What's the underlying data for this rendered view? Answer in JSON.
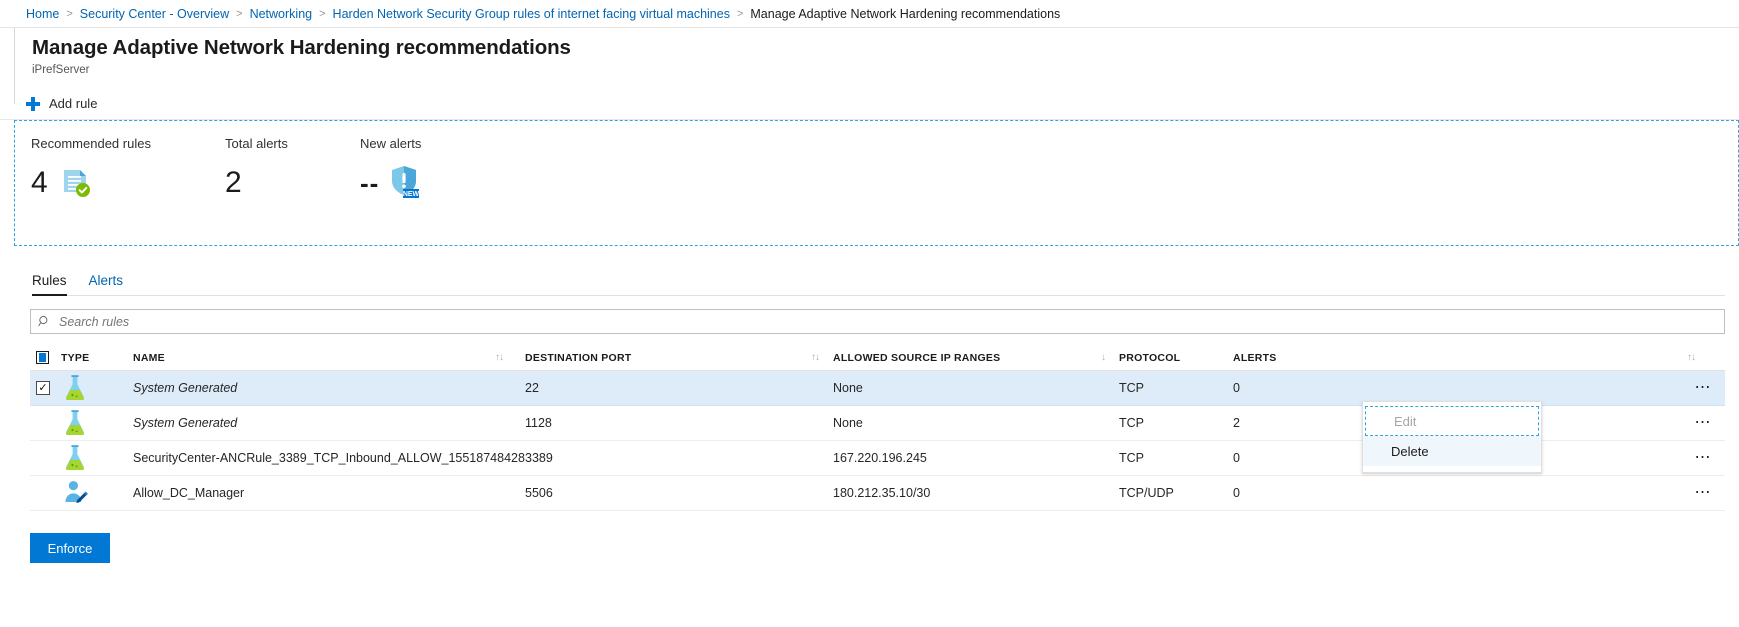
{
  "breadcrumb": {
    "items": [
      {
        "label": "Home",
        "link": true
      },
      {
        "label": "Security Center - Overview",
        "link": true
      },
      {
        "label": "Networking",
        "link": true
      },
      {
        "label": "Harden Network Security Group rules of internet facing virtual machines",
        "link": true
      },
      {
        "label": "Manage Adaptive Network Hardening recommendations",
        "link": false
      }
    ],
    "separator": ">"
  },
  "header": {
    "title": "Manage Adaptive Network Hardening recommendations",
    "subtitle": "iPrefServer"
  },
  "toolbar": {
    "add_rule_label": "Add rule",
    "add_rule_icon": "plus-icon"
  },
  "stats": [
    {
      "label": "Recommended rules",
      "value": "4",
      "icon": "rules-document-icon"
    },
    {
      "label": "Total alerts",
      "value": "2",
      "icon": ""
    },
    {
      "label": "New alerts",
      "value": "--",
      "icon": "new-alert-shield-icon",
      "badge": "NEW"
    }
  ],
  "tabs": [
    {
      "label": "Rules",
      "active": true
    },
    {
      "label": "Alerts",
      "active": false
    }
  ],
  "search": {
    "placeholder": "Search rules",
    "value": "",
    "icon": "search-icon"
  },
  "table": {
    "columns": [
      {
        "label": "TYPE",
        "sortable": false
      },
      {
        "label": "NAME",
        "sortable": true,
        "sort_icon": "sort-updown-icon"
      },
      {
        "label": "DESTINATION PORT",
        "sortable": true,
        "sort_icon": "sort-updown-icon"
      },
      {
        "label": "ALLOWED SOURCE IP RANGES",
        "sortable": true,
        "sort_icon": "sort-down-icon"
      },
      {
        "label": "PROTOCOL",
        "sortable": false
      },
      {
        "label": "ALERTS",
        "sortable": true,
        "sort_icon": "sort-updown-icon"
      }
    ],
    "select_all_checked": true,
    "rows": [
      {
        "checked": true,
        "selected": true,
        "type_icon": "flask-icon",
        "name": "System Generated",
        "name_italic": true,
        "destination_port": "22",
        "allowed_source_ip_ranges": "None",
        "protocol": "TCP",
        "alerts": "0",
        "menu_icon": "ellipsis-icon"
      },
      {
        "checked": false,
        "selected": false,
        "type_icon": "flask-icon",
        "name": "System Generated",
        "name_italic": true,
        "destination_port": "1128",
        "allowed_source_ip_ranges": "None",
        "protocol": "TCP",
        "alerts": "2",
        "menu_icon": "ellipsis-icon"
      },
      {
        "checked": false,
        "selected": false,
        "type_icon": "flask-icon",
        "name": "SecurityCenter-ANCRule_3389_TCP_Inbound_ALLOW_1551874842891",
        "name_italic": false,
        "destination_port": "3389",
        "allowed_source_ip_ranges": "167.220.196.245",
        "protocol": "TCP",
        "alerts": "0",
        "menu_icon": "ellipsis-icon"
      },
      {
        "checked": false,
        "selected": false,
        "type_icon": "user-edit-icon",
        "name": "Allow_DC_Manager",
        "name_italic": false,
        "destination_port": "5506",
        "allowed_source_ip_ranges": "180.212.35.10/30",
        "protocol": "TCP/UDP",
        "alerts": "0",
        "menu_icon": "ellipsis-icon"
      }
    ]
  },
  "context_menu": {
    "items": [
      {
        "label": "Edit",
        "disabled": true,
        "focused": true
      },
      {
        "label": "Delete",
        "disabled": false,
        "hover": true
      }
    ]
  },
  "footer": {
    "enforce_label": "Enforce"
  },
  "colors": {
    "accent": "#0078d4",
    "link": "#0065b3",
    "selected_row": "#deecf9",
    "focus_dash": "#30a4e0"
  }
}
